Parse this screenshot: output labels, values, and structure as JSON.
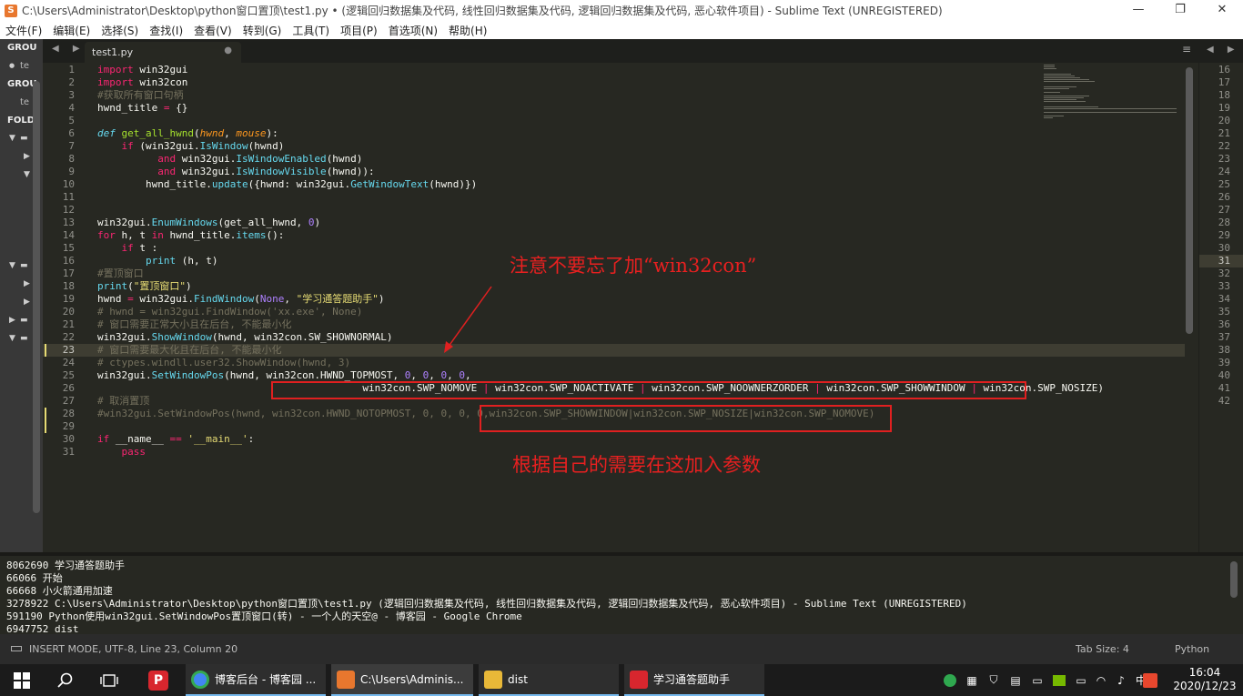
{
  "window": {
    "title": "C:\\Users\\Administrator\\Desktop\\python窗口置顶\\test1.py • (逻辑回归数据集及代码, 线性回归数据集及代码, 逻辑回归数据集及代码, 恶心软件项目) - Sublime Text (UNREGISTERED)",
    "minimize": "—",
    "maximize": "❐",
    "close": "✕"
  },
  "menu": [
    "文件(F)",
    "编辑(E)",
    "选择(S)",
    "查找(I)",
    "查看(V)",
    "转到(G)",
    "工具(T)",
    "项目(P)",
    "首选项(N)",
    "帮助(H)"
  ],
  "sidebar": {
    "group1": "GROU",
    "file1": "te",
    "group2": "GROU",
    "file2": "te",
    "folders": "FOLD"
  },
  "tabs": {
    "nav": "◀ ▶",
    "active_tab": "test1.py",
    "close": "●",
    "menu": "≡"
  },
  "editor": {
    "line_numbers": [
      "1",
      "2",
      "3",
      "4",
      "5",
      "6",
      "7",
      "8",
      "9",
      "10",
      "11",
      "12",
      "13",
      "14",
      "15",
      "16",
      "17",
      "18",
      "19",
      "20",
      "21",
      "22",
      "23",
      "24",
      "25",
      "26",
      "27",
      "28",
      "29",
      "30",
      "31"
    ],
    "active_line": "23"
  },
  "annotations": {
    "note1": "注意不要忘了加“win32con”",
    "note2": "根据自己的需要在这加入参数"
  },
  "right_panel": {
    "nav": "◀ ▶",
    "line_numbers": [
      "16",
      "17",
      "18",
      "19",
      "20",
      "21",
      "22",
      "23",
      "24",
      "25",
      "26",
      "27",
      "28",
      "29",
      "30",
      "31",
      "32",
      "33",
      "34",
      "35",
      "36",
      "37",
      "38",
      "39",
      "40",
      "41",
      "42"
    ],
    "active_line": "31"
  },
  "console": {
    "lines": [
      "8062690 学习通答题助手",
      "66066 开始",
      "66668 小火箭通用加速",
      "3278922 C:\\Users\\Administrator\\Desktop\\python窗口置顶\\test1.py (逻辑回归数据集及代码, 线性回归数据集及代码, 逻辑回归数据集及代码, 恶心软件项目) - Sublime Text (UNREGISTERED)",
      "591190 Python使用win32gui.SetWindowPos置顶窗口(转) - 一个人的天空@ - 博客园 - Google Chrome",
      "6947752 dist"
    ]
  },
  "status": {
    "mode": "INSERT MODE, UTF-8, Line 23, Column 20",
    "tab_size": "Tab Size: 4",
    "syntax": "Python"
  },
  "taskbar": {
    "tasks": [
      {
        "label": "博客后台 - 博客园 ...",
        "color": "#4285f4"
      },
      {
        "label": "C:\\Users\\Adminis...",
        "color": "#e8772e"
      },
      {
        "label": "dist",
        "color": "#e8b838"
      },
      {
        "label": "学习通答题助手",
        "color": "#d8262e"
      }
    ],
    "ime": "中",
    "time": "16:04",
    "date": "2020/12/23"
  }
}
